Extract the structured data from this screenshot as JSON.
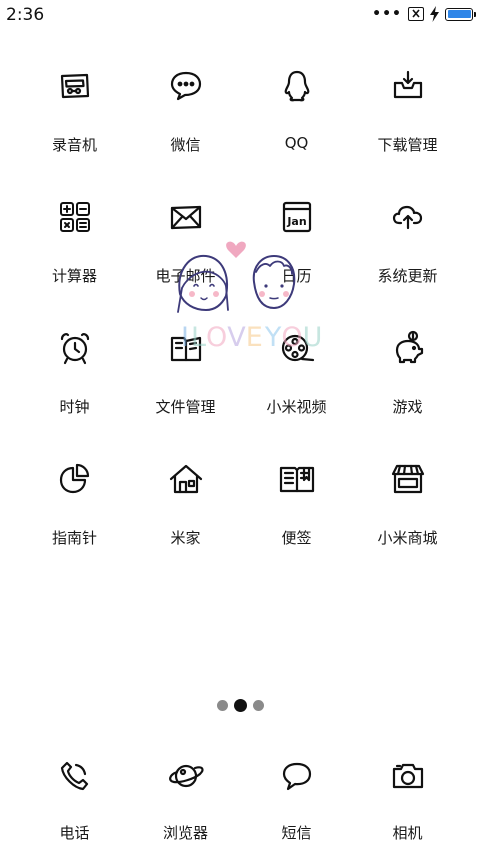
{
  "status_bar": {
    "time": "2:36",
    "overflow": "•••",
    "battery_level": 1.0,
    "battery_color": "#2f86e8"
  },
  "apps": [
    {
      "label": "录音机",
      "icon": "recorder-icon"
    },
    {
      "label": "微信",
      "icon": "wechat-icon"
    },
    {
      "label": "QQ",
      "icon": "qq-icon"
    },
    {
      "label": "下载管理",
      "icon": "download-icon"
    },
    {
      "label": "计算器",
      "icon": "calculator-icon"
    },
    {
      "label": "电子邮件",
      "icon": "email-icon"
    },
    {
      "label": "日历",
      "icon": "calendar-icon",
      "icon_text": "Jan"
    },
    {
      "label": "系统更新",
      "icon": "cloud-upload-icon"
    },
    {
      "label": "时钟",
      "icon": "alarm-clock-icon"
    },
    {
      "label": "文件管理",
      "icon": "folder-book-icon"
    },
    {
      "label": "小米视频",
      "icon": "film-reel-icon"
    },
    {
      "label": "游戏",
      "icon": "piggy-bank-icon"
    },
    {
      "label": "指南针",
      "icon": "pie-chart-icon"
    },
    {
      "label": "米家",
      "icon": "house-icon"
    },
    {
      "label": "便签",
      "icon": "open-book-icon"
    },
    {
      "label": "小米商城",
      "icon": "store-icon"
    }
  ],
  "wallpaper": {
    "text": "I LOVE YOU"
  },
  "pager": {
    "pages": 3,
    "active": 2
  },
  "dock": [
    {
      "label": "电话",
      "icon": "phone-icon"
    },
    {
      "label": "浏览器",
      "icon": "planet-icon"
    },
    {
      "label": "短信",
      "icon": "message-bubble-icon"
    },
    {
      "label": "相机",
      "icon": "camera-icon"
    }
  ]
}
